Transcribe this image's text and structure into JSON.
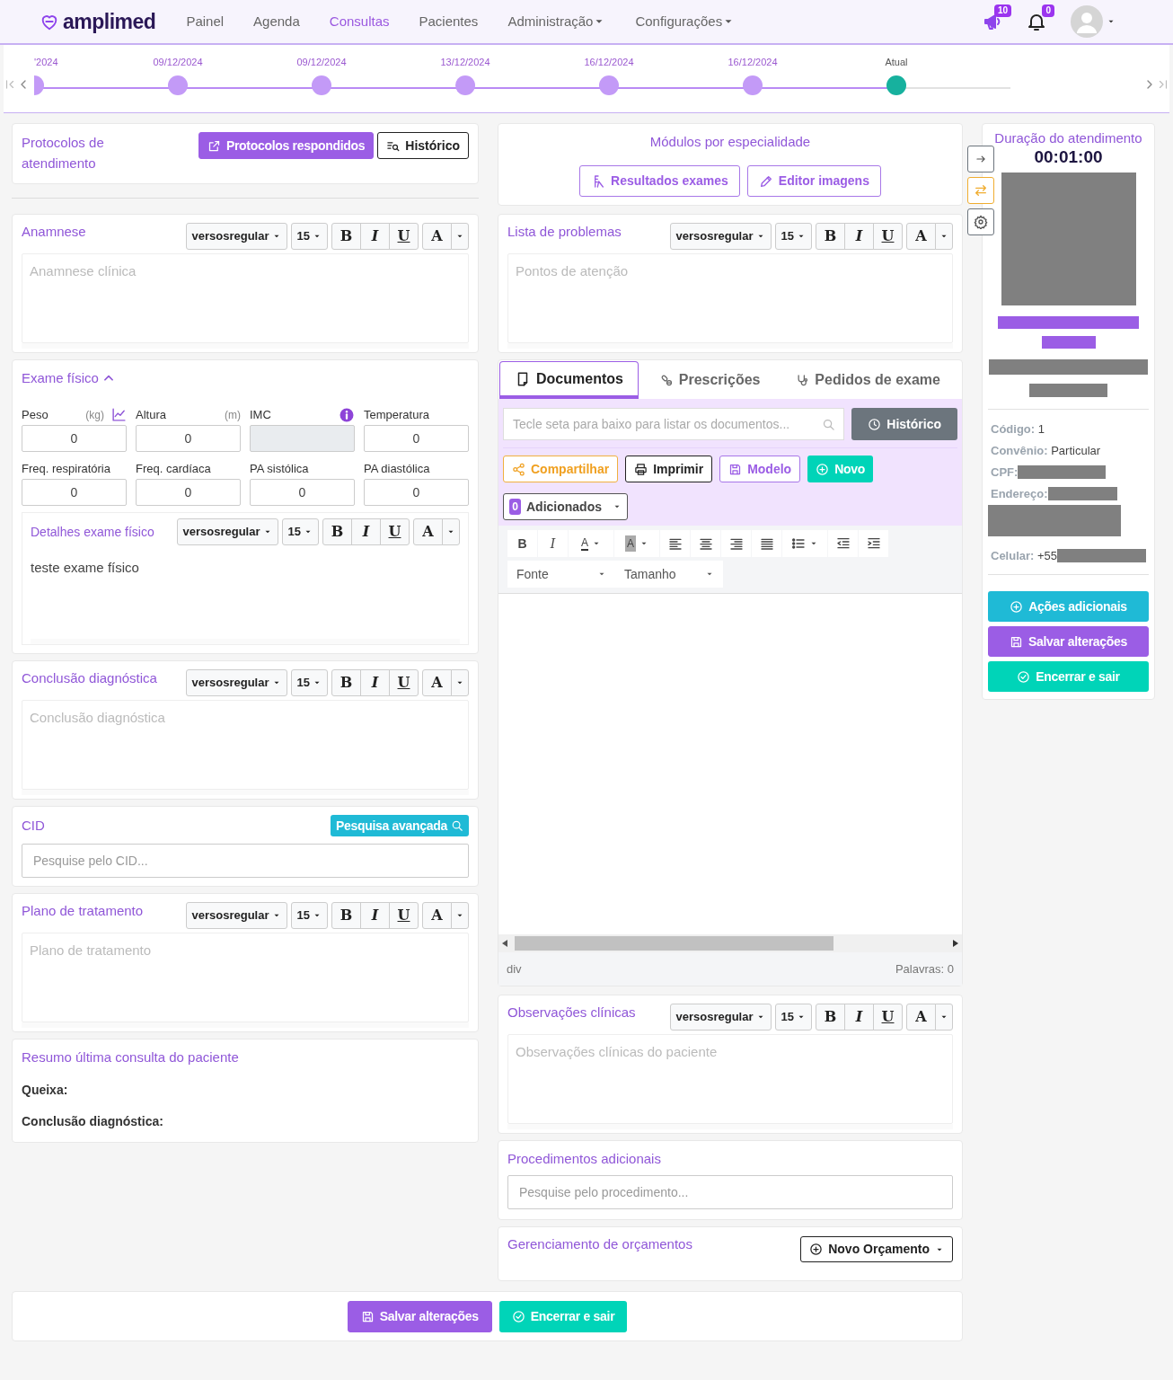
{
  "nav": {
    "logo": "amplimed",
    "items": [
      {
        "label": "Painel",
        "selected": false,
        "dropdown": false
      },
      {
        "label": "Agenda",
        "selected": false,
        "dropdown": false
      },
      {
        "label": "Consultas",
        "selected": true,
        "dropdown": false
      },
      {
        "label": "Pacientes",
        "selected": false,
        "dropdown": false
      },
      {
        "label": "Administração",
        "selected": false,
        "dropdown": true
      },
      {
        "label": "Configurações",
        "selected": false,
        "dropdown": true
      }
    ],
    "megaphone_badge": "10",
    "bell_badge": "0"
  },
  "timeline": {
    "points": [
      {
        "label": "'2024",
        "current": false,
        "clipped": true
      },
      {
        "label": "09/12/2024",
        "current": false,
        "clipped": false
      },
      {
        "label": "09/12/2024",
        "current": false,
        "clipped": false
      },
      {
        "label": "13/12/2024",
        "current": false,
        "clipped": false
      },
      {
        "label": "16/12/2024",
        "current": false,
        "clipped": false
      },
      {
        "label": "16/12/2024",
        "current": false,
        "clipped": false
      },
      {
        "label": "Atual",
        "current": true,
        "clipped": false
      }
    ]
  },
  "protocols": {
    "title": "Protocolos de atendimento",
    "buttons": [
      "Protocolos respondidos",
      "Histórico"
    ]
  },
  "anamnese": {
    "title": "Anamnese",
    "toolbar": {
      "font": "versosregular",
      "size": "15",
      "bold": "B",
      "italic": "I",
      "underline": "U",
      "font_color": "A"
    },
    "placeholder": "Anamnese clínica"
  },
  "exam": {
    "title": "Exame físico",
    "expanded": true,
    "fields": [
      {
        "label": "Peso",
        "unit": "(kg)",
        "value": "0",
        "disabled": false,
        "kind": "trend"
      },
      {
        "label": "Altura",
        "unit": "(m)",
        "value": "0",
        "disabled": false,
        "kind": "plain"
      },
      {
        "label": "IMC",
        "disabled": true,
        "kind": "computed"
      },
      {
        "label": "Temperatura",
        "value": "0",
        "disabled": false,
        "kind": "plain"
      },
      {
        "label": "Freq. respiratória",
        "value": "0",
        "disabled": false,
        "kind": "plain"
      },
      {
        "label": "Freq. cardíaca",
        "value": "0",
        "disabled": false,
        "kind": "plain"
      },
      {
        "label": "PA sistólica",
        "value": "0",
        "disabled": false,
        "kind": "plain"
      },
      {
        "label": "PA diastólica",
        "value": "0",
        "disabled": false,
        "kind": "plain"
      }
    ],
    "details": {
      "title": "Detalhes exame físico",
      "toolbar": {
        "font": "versosregular",
        "size": "15",
        "bold": "B",
        "italic": "I",
        "underline": "U",
        "font_color": "A"
      },
      "value": "teste exame físico"
    }
  },
  "conclusion": {
    "title": "Conclusão diagnóstica",
    "toolbar": {
      "font": "versosregular",
      "size": "15",
      "bold": "B",
      "italic": "I",
      "underline": "U",
      "font_color": "A"
    },
    "placeholder": "Conclusão diagnóstica"
  },
  "cid": {
    "title": "CID",
    "button": "Pesquisa avançada",
    "placeholder": "Pesquise pelo CID..."
  },
  "plan": {
    "title": "Plano de tratamento",
    "toolbar": {
      "font": "versosregular",
      "size": "15",
      "bold": "B",
      "italic": "I",
      "underline": "U",
      "font_color": "A"
    },
    "placeholder": "Plano de tratamento"
  },
  "summary": {
    "title": "Resumo última consulta do paciente",
    "labels": [
      "Queixa:",
      "Conclusão diagnóstica:"
    ]
  },
  "modules": {
    "title": "Módulos por especialidade",
    "buttons": [
      "Resultados exames",
      "Editor imagens"
    ]
  },
  "problems": {
    "title": "Lista de problemas",
    "toolbar": {
      "font": "versosregular",
      "size": "15",
      "bold": "B",
      "italic": "I",
      "underline": "U",
      "font_color": "A"
    },
    "placeholder": "Pontos de atenção"
  },
  "documents": {
    "tabs": [
      {
        "label": "Documentos",
        "selected": true,
        "kind": "document"
      },
      {
        "label": "Prescrições",
        "selected": false,
        "kind": "pills"
      },
      {
        "label": "Pedidos de exame",
        "selected": false,
        "kind": "stethoscope"
      }
    ],
    "search_placeholder": "Tecle seta para baixo para listar os documentos...",
    "history_button": "Histórico",
    "actions": [
      {
        "label": "Compartilhar",
        "kind": "share"
      },
      {
        "label": "Imprimir",
        "kind": "print"
      },
      {
        "label": "Modelo",
        "kind": "template"
      },
      {
        "label": "Novo",
        "kind": "new"
      }
    ],
    "added": {
      "count": "0",
      "label": "Adicionados"
    },
    "editor_toolbar": {
      "bold": "B",
      "italic": "I",
      "font_color": "A",
      "highlight": "A",
      "font_select": "Fonte",
      "size_select": "Tamanho"
    },
    "status_path": "div",
    "word_count": "Palavras: 0"
  },
  "observations": {
    "title": "Observações clínicas",
    "toolbar": {
      "font": "versosregular",
      "size": "15",
      "bold": "B",
      "italic": "I",
      "underline": "U",
      "font_color": "A"
    },
    "placeholder": "Observações clínicas do paciente"
  },
  "procedures": {
    "title": "Procedimentos adicionais",
    "placeholder": "Pesquise pelo procedimento..."
  },
  "budgets": {
    "title": "Gerenciamento de orçamentos",
    "button": "Novo Orçamento"
  },
  "patient": {
    "duration_label": "Duração do atendimento",
    "timer": "00:01:00",
    "info": [
      {
        "label": "Código:",
        "value": "1",
        "kind": "plain"
      },
      {
        "label": "Convênio:",
        "value": "Particular",
        "kind": "plain"
      },
      {
        "label": "CPF:",
        "kind": "redacted"
      },
      {
        "label": "Endereço:",
        "kind": "redacted-multiline"
      },
      {
        "label": "Celular:",
        "value": "+55",
        "kind": "prefix-redacted"
      }
    ],
    "buttons": [
      {
        "label": "Ações adicionais",
        "kind": "actions"
      },
      {
        "label": "Salvar alterações",
        "kind": "save"
      },
      {
        "label": "Encerrar e sair",
        "kind": "finish"
      }
    ]
  },
  "footer": {
    "buttons": [
      {
        "label": "Salvar alterações",
        "kind": "save"
      },
      {
        "label": "Encerrar e sair",
        "kind": "finish"
      }
    ]
  }
}
